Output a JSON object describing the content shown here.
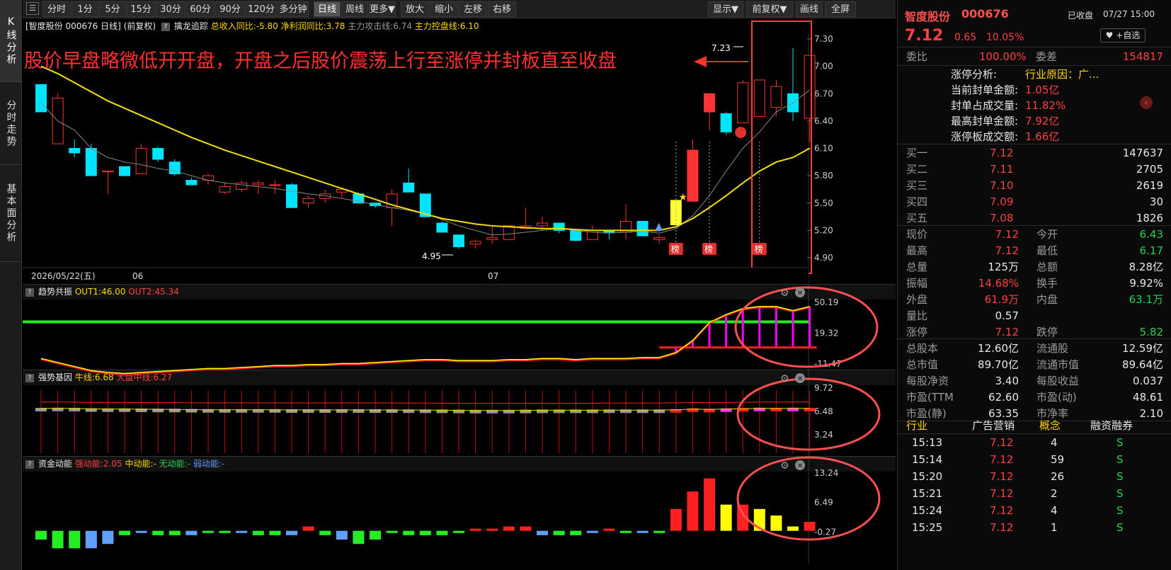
{
  "tabs": [
    "K线分析",
    "分时走势",
    "基本面分析"
  ],
  "toolbar": {
    "periods": [
      "分时",
      "1分",
      "5分",
      "15分",
      "30分",
      "60分",
      "90分",
      "120分",
      "多分钟",
      "日线",
      "周线",
      "更多▼",
      "放大",
      "缩小",
      "左移",
      "右移"
    ],
    "right": [
      "显示▼",
      "前复权▼",
      "画线",
      "全屏"
    ]
  },
  "info": {
    "stock": "[智度股份 000676 日线]",
    "adj": "(前复权)",
    "indicator": "擒龙追踪",
    "i1": "总收入同比:-5.80",
    "i2": "净利润同比:3.78",
    "i3": "主力攻击线:6.74",
    "i4": "主力控盘线:6.10"
  },
  "annotation": "股价早盘略微低开开盘，开盘之后股价震荡上行至涨停并封板直至收盘",
  "labels": {
    "high": "7.23",
    "low": "4.95",
    "date": "2026/05/22(五)",
    "m1": "06",
    "m2": "07",
    "bang": "榜"
  },
  "price_axis": [
    "7.30",
    "7.00",
    "6.70",
    "6.40",
    "6.10",
    "5.80",
    "5.50",
    "5.20",
    "4.90"
  ],
  "panel1": {
    "title": "趋势共振",
    "out1": "OUT1:46.00",
    "out2": "OUT2:45.34",
    "axis": [
      "50.19",
      "19.32",
      "-11.47"
    ]
  },
  "panel2": {
    "title": "强势基因",
    "bull": "牛线:6.68",
    "mid": "大盘中线:6.27",
    "axis": [
      "9.72",
      "6.48",
      "3.24"
    ]
  },
  "panel3": {
    "title": "资金动能",
    "strong": "强动能:2.05",
    "medium": "中动能:-",
    "none": "无动能:-",
    "weak": "弱动能:-",
    "axis": [
      "13.24",
      "6.49",
      "-0.27"
    ]
  },
  "chart_data": {
    "type": "candlestick",
    "ohlc": [
      [
        6.8,
        6.8,
        6.5,
        6.5
      ],
      [
        6.15,
        6.7,
        6.15,
        6.65
      ],
      [
        6.1,
        6.2,
        6.0,
        6.05
      ],
      [
        6.1,
        6.15,
        5.85,
        5.8
      ],
      [
        5.85,
        5.85,
        5.6,
        5.85
      ],
      [
        5.9,
        5.9,
        5.8,
        5.8
      ],
      [
        5.82,
        6.15,
        5.82,
        6.1
      ],
      [
        6.1,
        6.12,
        5.95,
        5.98
      ],
      [
        5.95,
        5.98,
        5.8,
        5.82
      ],
      [
        5.75,
        5.78,
        5.7,
        5.7
      ],
      [
        5.75,
        5.82,
        5.7,
        5.8
      ],
      [
        5.62,
        5.72,
        5.6,
        5.68
      ],
      [
        5.65,
        5.75,
        5.62,
        5.72
      ],
      [
        5.7,
        5.75,
        5.6,
        5.72
      ],
      [
        5.7,
        5.75,
        5.6,
        5.7
      ],
      [
        5.7,
        5.72,
        5.45,
        5.45
      ],
      [
        5.5,
        5.58,
        5.45,
        5.55
      ],
      [
        5.55,
        5.65,
        5.5,
        5.6
      ],
      [
        5.62,
        5.66,
        5.55,
        5.65
      ],
      [
        5.6,
        5.62,
        5.5,
        5.5
      ],
      [
        5.5,
        5.5,
        5.45,
        5.47
      ],
      [
        5.45,
        5.65,
        5.25,
        5.6
      ],
      [
        5.72,
        5.88,
        5.62,
        5.62
      ],
      [
        5.6,
        5.6,
        5.35,
        5.35
      ],
      [
        5.28,
        5.3,
        5.18,
        5.18
      ],
      [
        5.15,
        5.15,
        5.0,
        5.02
      ],
      [
        5.05,
        5.1,
        5.0,
        5.08
      ],
      [
        5.1,
        5.25,
        5.05,
        5.12
      ],
      [
        5.1,
        5.25,
        5.1,
        5.25
      ],
      [
        5.22,
        5.45,
        5.22,
        5.25
      ],
      [
        5.25,
        5.35,
        5.2,
        5.28
      ],
      [
        5.28,
        5.28,
        5.17,
        5.2
      ],
      [
        5.2,
        5.2,
        5.08,
        5.09
      ],
      [
        5.1,
        5.25,
        5.1,
        5.2
      ],
      [
        5.2,
        5.2,
        5.1,
        5.18
      ],
      [
        5.18,
        5.48,
        5.1,
        5.3
      ],
      [
        5.3,
        5.3,
        5.14,
        5.14
      ],
      [
        5.1,
        5.15,
        5.05,
        5.12
      ],
      [
        5.26,
        5.53,
        5.26,
        5.53
      ],
      [
        5.52,
        6.2,
        5.52,
        6.08
      ],
      [
        6.5,
        6.7,
        6.3,
        6.7
      ],
      [
        6.48,
        6.5,
        6.25,
        6.28
      ],
      [
        6.38,
        6.85,
        6.38,
        6.82
      ],
      [
        6.45,
        6.85,
        6.45,
        6.85
      ],
      [
        6.55,
        6.85,
        6.45,
        6.78
      ],
      [
        6.7,
        7.2,
        6.4,
        6.5
      ],
      [
        6.43,
        7.12,
        6.17,
        7.12
      ]
    ],
    "ma5": [
      6.6,
      6.4,
      6.3,
      6.1,
      6.0,
      5.95,
      5.92,
      5.88,
      5.85,
      5.8,
      5.75,
      5.72,
      5.7,
      5.68,
      5.66,
      5.63,
      5.6,
      5.58,
      5.55,
      5.52,
      5.48,
      5.45,
      5.42,
      5.38,
      5.32,
      5.25,
      5.2,
      5.15,
      5.16,
      5.18,
      5.2,
      5.22,
      5.2,
      5.18,
      5.17,
      5.18,
      5.19,
      5.17,
      5.22,
      5.36,
      5.58,
      5.85,
      6.1,
      6.28,
      6.5,
      6.6,
      6.74
    ],
    "ma20": [
      7.0,
      6.92,
      6.82,
      6.72,
      6.62,
      6.54,
      6.46,
      6.38,
      6.3,
      6.22,
      6.15,
      6.08,
      6.02,
      5.96,
      5.9,
      5.84,
      5.78,
      5.72,
      5.66,
      5.6,
      5.54,
      5.48,
      5.43,
      5.38,
      5.33,
      5.3,
      5.27,
      5.25,
      5.24,
      5.23,
      5.22,
      5.22,
      5.21,
      5.2,
      5.2,
      5.2,
      5.2,
      5.2,
      5.24,
      5.33,
      5.45,
      5.58,
      5.72,
      5.85,
      5.95,
      6.0,
      6.1
    ],
    "trend_out1": [
      -6,
      -10,
      -14,
      -18,
      -20,
      -21,
      -20,
      -19,
      -18,
      -17,
      -16,
      -16,
      -15,
      -14,
      -13,
      -13,
      -12,
      -12,
      -11,
      -11,
      -10,
      -9,
      -8,
      -7,
      -7,
      -8,
      -8,
      -8,
      -7,
      -7,
      -6,
      -6,
      -7,
      -6,
      -6,
      -6,
      -5,
      -5,
      0,
      12,
      30,
      38,
      44,
      46,
      46,
      42,
      46
    ],
    "strong_bull": [
      6.68,
      6.7,
      6.68,
      6.62,
      6.6,
      6.6,
      6.58,
      6.56,
      6.55,
      6.52,
      6.5,
      6.5,
      6.5,
      6.5,
      6.5,
      6.48,
      6.48,
      6.48,
      6.48,
      6.48,
      6.48,
      6.47,
      6.46,
      6.45,
      6.44,
      6.42,
      6.4,
      6.4,
      6.4,
      6.42,
      6.44,
      6.44,
      6.44,
      6.44,
      6.45,
      6.45,
      6.45,
      6.45,
      6.5,
      6.6,
      6.55,
      6.6,
      6.65,
      6.7,
      6.68,
      6.7,
      6.68
    ],
    "energy": [
      -2,
      -4,
      -4,
      -4,
      -3,
      -1,
      -0.5,
      -1,
      -1,
      -1,
      -0.5,
      -0.5,
      -0.5,
      -1,
      -1,
      -1,
      1,
      -1,
      -2,
      -3,
      -2,
      -0.5,
      -1,
      -1,
      -1,
      -0.5,
      0.5,
      0.5,
      1,
      1,
      -1,
      -1,
      -1,
      -0.5,
      0.5,
      -0.5,
      -0.5,
      -0.5,
      5,
      9,
      12,
      6,
      6,
      5,
      3.5,
      1,
      2.05
    ]
  },
  "side": {
    "name": "智度股份",
    "code": "000676",
    "status": "已收盘",
    "time": "07/27 15:00",
    "price": "7.12",
    "change": "0.65",
    "pct": "10.05%",
    "fav": "+自选",
    "wb_l": "委比",
    "wb": "100.00%",
    "wc_l": "委差",
    "wc": "154817",
    "limit": [
      [
        "涨停分析:",
        "行业原因：广..."
      ],
      [
        "当前封单金额:",
        "1.05亿"
      ],
      [
        "封单占成交量:",
        "11.82%"
      ],
      [
        "最高封单金额:",
        "7.92亿"
      ],
      [
        "涨停板成交额:",
        "1.66亿"
      ]
    ],
    "bids": [
      [
        "买一",
        "7.12",
        "147637"
      ],
      [
        "买二",
        "7.11",
        "2705"
      ],
      [
        "买三",
        "7.10",
        "2619"
      ],
      [
        "买四",
        "7.09",
        "30"
      ],
      [
        "买五",
        "7.08",
        "1826"
      ]
    ],
    "q": [
      [
        "现价",
        "7.12",
        "今开",
        "6.43"
      ],
      [
        "最高",
        "7.12",
        "最低",
        "6.17"
      ],
      [
        "总量",
        "125万",
        "总额",
        "8.28亿"
      ],
      [
        "振幅",
        "14.68%",
        "换手",
        "9.92%"
      ],
      [
        "外盘",
        "61.9万",
        "内盘",
        "63.1万"
      ],
      [
        "量比",
        "0.57",
        "",
        ""
      ],
      [
        "涨停",
        "7.12",
        "跌停",
        "5.82"
      ],
      [
        "总股本",
        "12.60亿",
        "流通股",
        "12.59亿"
      ],
      [
        "总市值",
        "89.70亿",
        "流通市值",
        "89.64亿"
      ],
      [
        "每股净资",
        "3.40",
        "每股收益",
        "0.037"
      ],
      [
        "市盈(TTM",
        "62.60",
        "市盈(动)",
        "48.61"
      ],
      [
        "市盈(静)",
        "63.35",
        "市净率",
        "2.10"
      ]
    ],
    "tags": [
      "行业",
      "广告营销",
      "概念",
      "融资融券"
    ],
    "ticks": [
      [
        "15:13",
        "7.12",
        "4",
        "S"
      ],
      [
        "15:14",
        "7.12",
        "59",
        "S"
      ],
      [
        "15:20",
        "7.12",
        "26",
        "S"
      ],
      [
        "15:21",
        "7.12",
        "2",
        "S"
      ],
      [
        "15:24",
        "7.12",
        "4",
        "S"
      ],
      [
        "15:25",
        "7.12",
        "1",
        "S"
      ]
    ]
  }
}
